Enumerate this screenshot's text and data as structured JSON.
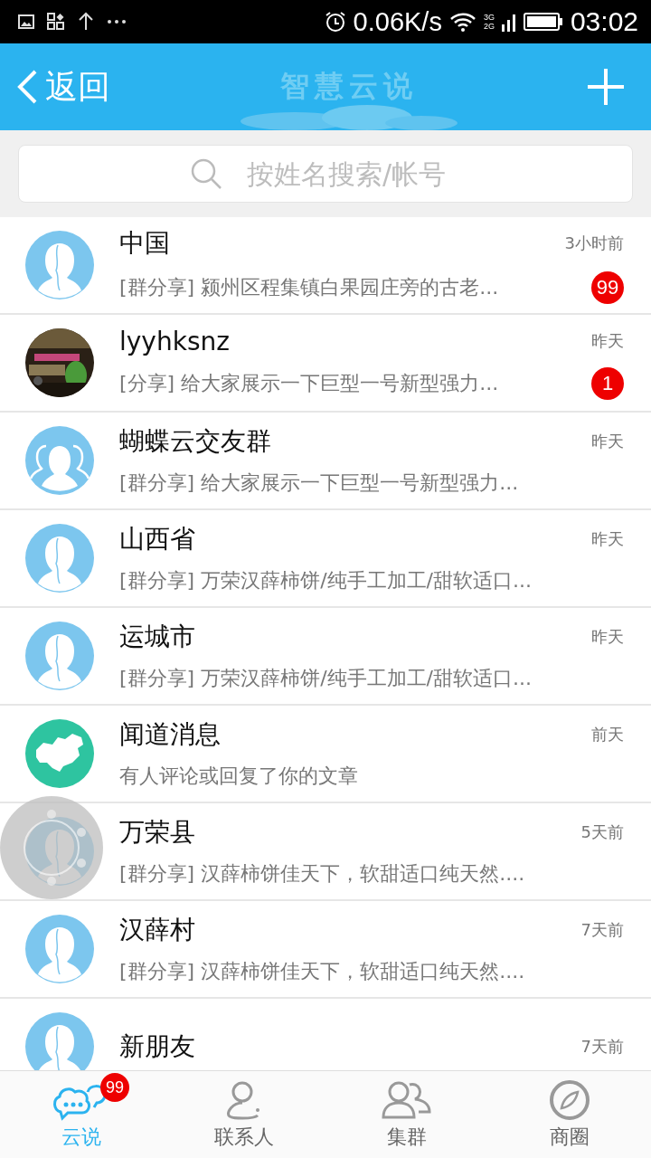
{
  "status_bar": {
    "speed": "0.06K/s",
    "network": [
      "3G",
      "2G"
    ],
    "time": "03:02"
  },
  "header": {
    "back": "返回",
    "title": "智慧云说"
  },
  "search": {
    "placeholder": "按姓名搜索/帐号"
  },
  "conversations": [
    {
      "name": "中国",
      "time": "3小时前",
      "preview": "[群分享] 颍州区程集镇白果园庄旁的古老...",
      "kind": "person",
      "unread": "99"
    },
    {
      "name": "lyyhksnz",
      "time": "昨天",
      "preview": "[分享] 给大家展示一下巨型一号新型强力...",
      "kind": "picture",
      "unread": "1"
    },
    {
      "name": "蝴蝶云交友群",
      "time": "昨天",
      "preview": "[群分享] 给大家展示一下巨型一号新型强力...",
      "kind": "group"
    },
    {
      "name": "山西省",
      "time": "昨天",
      "preview": "[群分享] 万荣汉薛柿饼/纯手工加工/甜软适口...",
      "kind": "person"
    },
    {
      "name": "运城市",
      "time": "昨天",
      "preview": "[群分享] 万荣汉薛柿饼/纯手工加工/甜软适口...",
      "kind": "person"
    },
    {
      "name": "闻道消息",
      "time": "前天",
      "preview": "有人评论或回复了你的文章",
      "kind": "map"
    },
    {
      "name": "万荣县",
      "time": "5天前",
      "preview": "[群分享]  汉薛柿饼佳天下，软甜适口纯天然....",
      "kind": "person"
    },
    {
      "name": "汉薛村",
      "time": "7天前",
      "preview": "[群分享]  汉薛柿饼佳天下，软甜适口纯天然....",
      "kind": "person"
    },
    {
      "name": "新朋友",
      "time": "7天前",
      "kind": "person"
    }
  ],
  "tabs": [
    {
      "label": "云说",
      "kind": "chat",
      "selected": true,
      "badge": "99"
    },
    {
      "label": "联系人",
      "kind": "contact",
      "selected": false
    },
    {
      "label": "集群",
      "kind": "group",
      "selected": false
    },
    {
      "label": "商圈",
      "kind": "compass",
      "selected": false
    }
  ]
}
